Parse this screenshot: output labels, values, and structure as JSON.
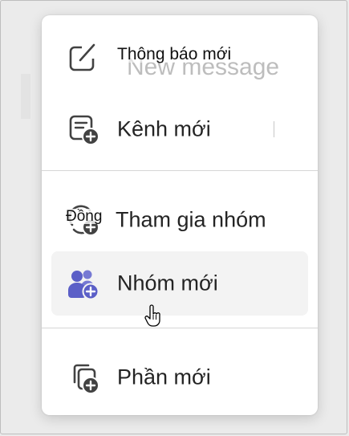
{
  "menu": {
    "items": [
      {
        "label": "Thông báo mới",
        "underlay_text": "New message",
        "icon": "compose-icon",
        "hovered": false
      },
      {
        "label": "Kênh mới",
        "icon": "channel-add-icon",
        "hovered": false
      },
      {
        "label": "Tham gia nhóm",
        "icon_overlay_text": "Đồng",
        "icon": "join-team-icon",
        "hovered": false
      },
      {
        "label": "Nhóm mới",
        "icon": "people-add-icon",
        "hovered": true
      },
      {
        "label": "Phần mới",
        "icon": "section-add-icon",
        "hovered": false
      }
    ]
  },
  "colors": {
    "accent": "#5b5fc7",
    "icon": "#424242",
    "text": "#242424",
    "hover": "#f3f3f3"
  },
  "cursor": "hand-pointer-icon"
}
